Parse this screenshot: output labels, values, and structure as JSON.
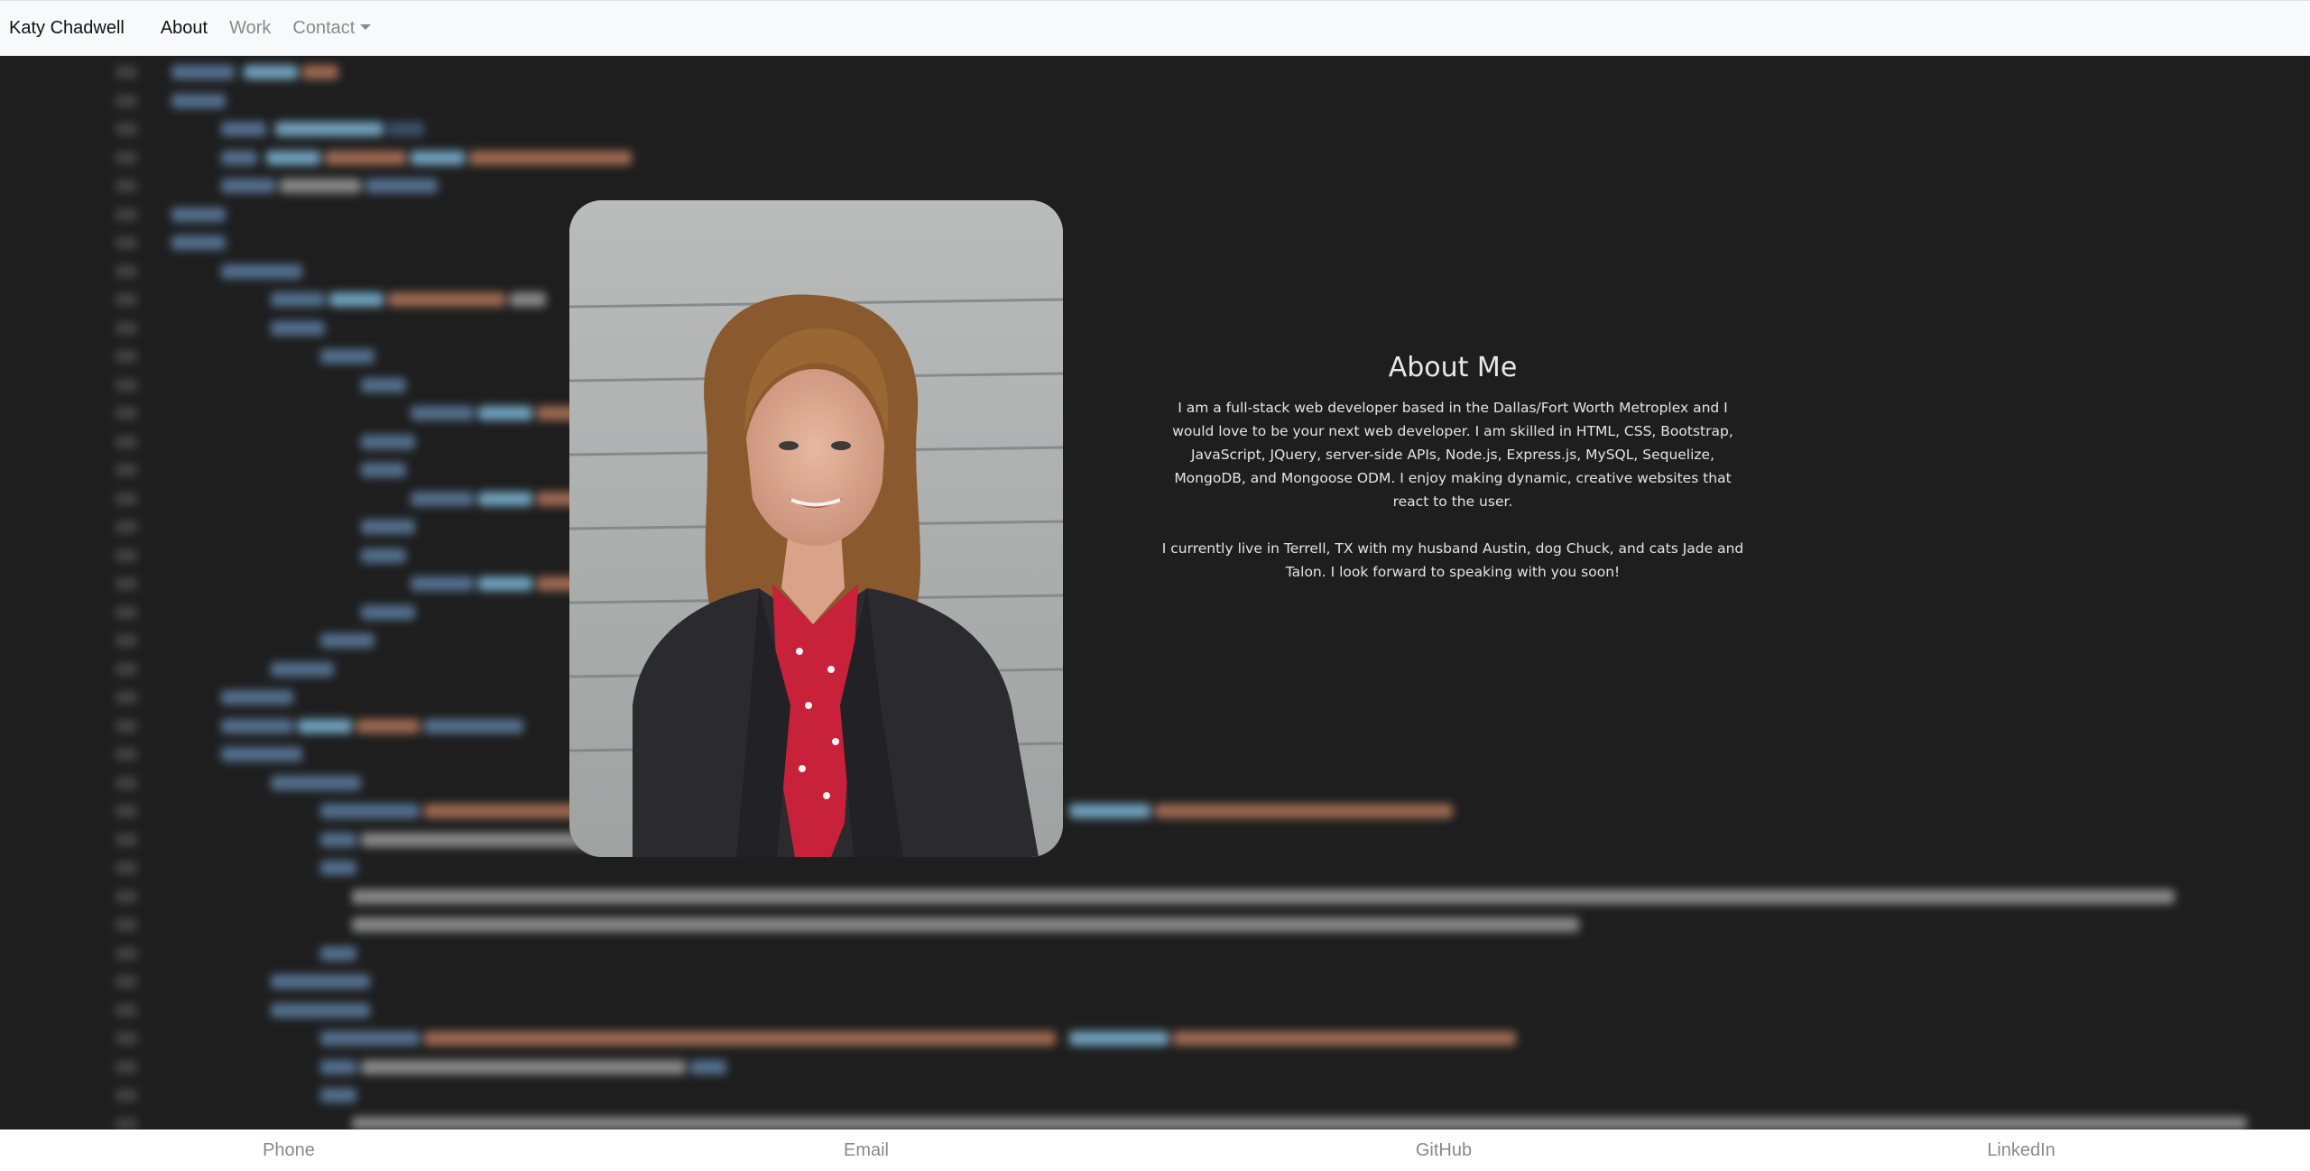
{
  "navbar": {
    "brand": "Katy Chadwell",
    "links": [
      {
        "label": "About",
        "active": true
      },
      {
        "label": "Work",
        "active": false
      },
      {
        "label": "Contact",
        "active": false,
        "dropdown": true
      }
    ]
  },
  "about": {
    "title": "About Me",
    "paragraph1": "I am a full-stack web developer based in the Dallas/Fort Worth Metroplex and I would love to be your next web developer. I am skilled in HTML, CSS, Bootstrap, JavaScript, JQuery, server-side APIs, Node.js, Express.js, MySQL, Sequelize, MongoDB, and Mongoose ODM. I enjoy making dynamic, creative websites that react to the user.",
    "paragraph2": "I currently live in Terrell, TX with my husband Austin, dog Chuck, and cats Jade and Talon. I look forward to speaking with you soon!"
  },
  "footer": {
    "links": [
      "Phone",
      "Email",
      "GitHub",
      "LinkedIn"
    ]
  },
  "colors": {
    "background": "#1e1e1e",
    "navbar": "#f8f9fa",
    "footer": "#ffffff",
    "accent_text": "#e6e6e6"
  }
}
